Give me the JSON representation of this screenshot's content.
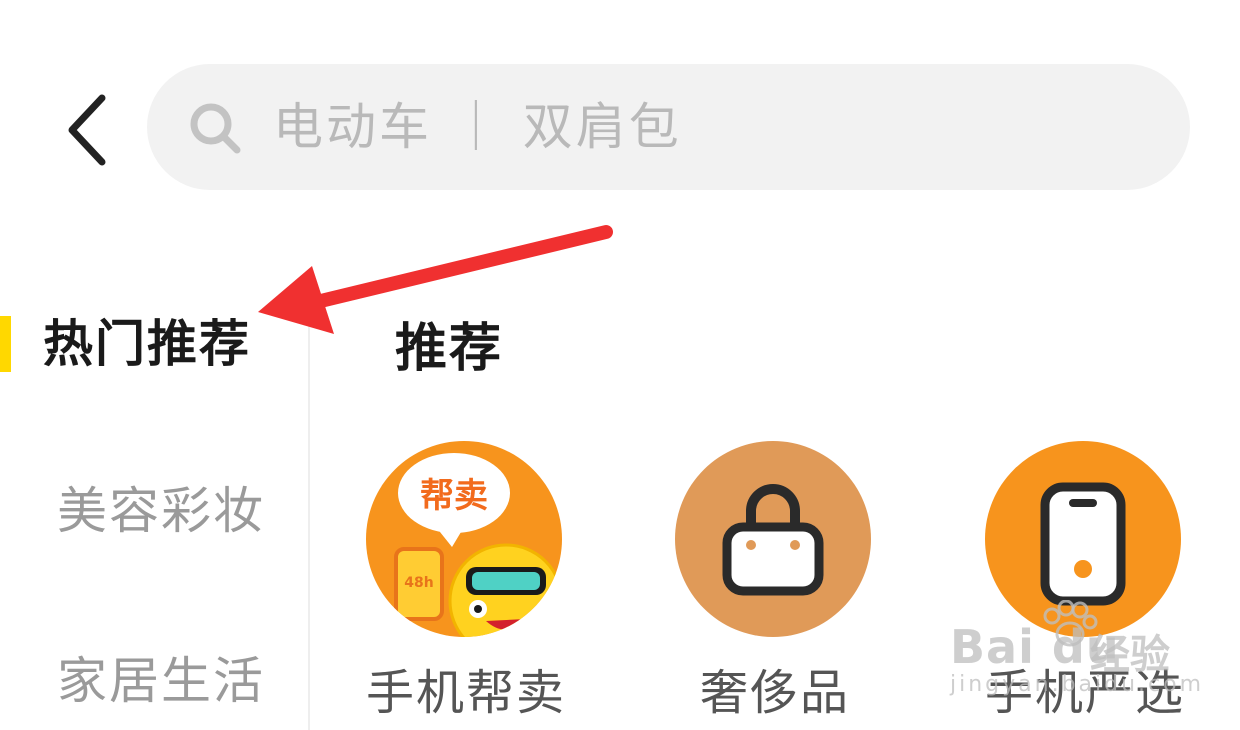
{
  "header": {
    "search_placeholder": "电动车 ｜ 双肩包"
  },
  "sidebar": {
    "items": [
      {
        "label": "热门推荐",
        "active": true
      },
      {
        "label": "美容彩妆",
        "active": false
      },
      {
        "label": "家居生活",
        "active": false
      }
    ]
  },
  "main": {
    "section_title": "推荐",
    "items": [
      {
        "label": "手机帮卖",
        "icon": "mascot-sell-icon",
        "badge_text": "帮卖",
        "phone_text": "48h"
      },
      {
        "label": "奢侈品",
        "icon": "shopping-bag-icon"
      },
      {
        "label": "手机严选",
        "icon": "phone-icon"
      }
    ]
  },
  "watermark": {
    "brand": "Bai du",
    "cn": "经验",
    "url": "jingyan.baidu.com"
  },
  "colors": {
    "accent_yellow": "#ffd800",
    "arrow_red": "#f03030",
    "orange": "#f7941d",
    "tan": "#e09a58"
  }
}
